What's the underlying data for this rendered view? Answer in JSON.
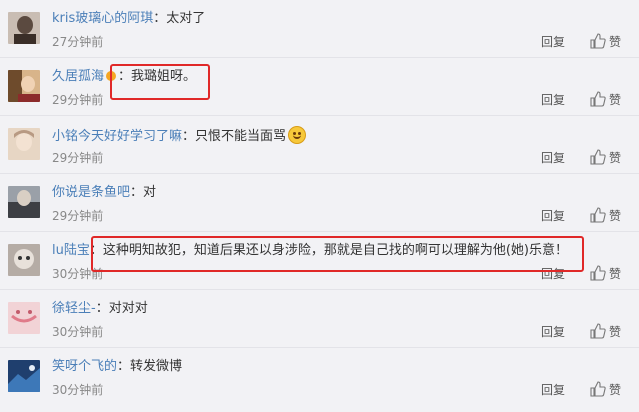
{
  "comments": [
    {
      "name": "kris玻璃心的阿琪",
      "content": "：太对了",
      "time": "27分钟前",
      "avatar_color": "#5b4a40",
      "avatar_icon": "user-photo"
    },
    {
      "name": "久居孤海",
      "content": "：我璐姐呀。",
      "time": "29分钟前",
      "avatar_color": "#6e4b2c",
      "avatar_icon": "user-photo"
    },
    {
      "name": "小铭今天好好学习了嘛",
      "content": "：只恨不能当面骂",
      "time": "29分钟前",
      "avatar_color": "#e7d6c4",
      "avatar_icon": "user-photo",
      "emoji": "smile-emoji"
    },
    {
      "name": "你说是条鱼吧",
      "content": "：对",
      "time": "29分钟前",
      "avatar_color": "#3d3f44",
      "avatar_icon": "user-photo"
    },
    {
      "name": "lu陆宝",
      "content": "：这种明知故犯，知道后果还以身涉险，那就是自己找的啊可以理解为他(她)乐意！",
      "time": "30分钟前",
      "avatar_color": "#b5aca5",
      "avatar_icon": "user-photo"
    },
    {
      "name": "徐轻尘-",
      "content": "：对对对",
      "time": "30分钟前",
      "avatar_color": "#f2d3d6",
      "avatar_icon": "user-photo"
    },
    {
      "name": "笑呀个飞的",
      "content": "：转发微博",
      "time": "30分钟前",
      "avatar_color": "#1f3f6e",
      "avatar_icon": "user-photo"
    }
  ],
  "actions": {
    "reply_label": "回复",
    "like_label": "赞",
    "like_icon": "thumbs-up-icon"
  },
  "colors": {
    "name": "#4b7fb8",
    "highlight": "#e02828",
    "background": "#f2f2f5"
  }
}
